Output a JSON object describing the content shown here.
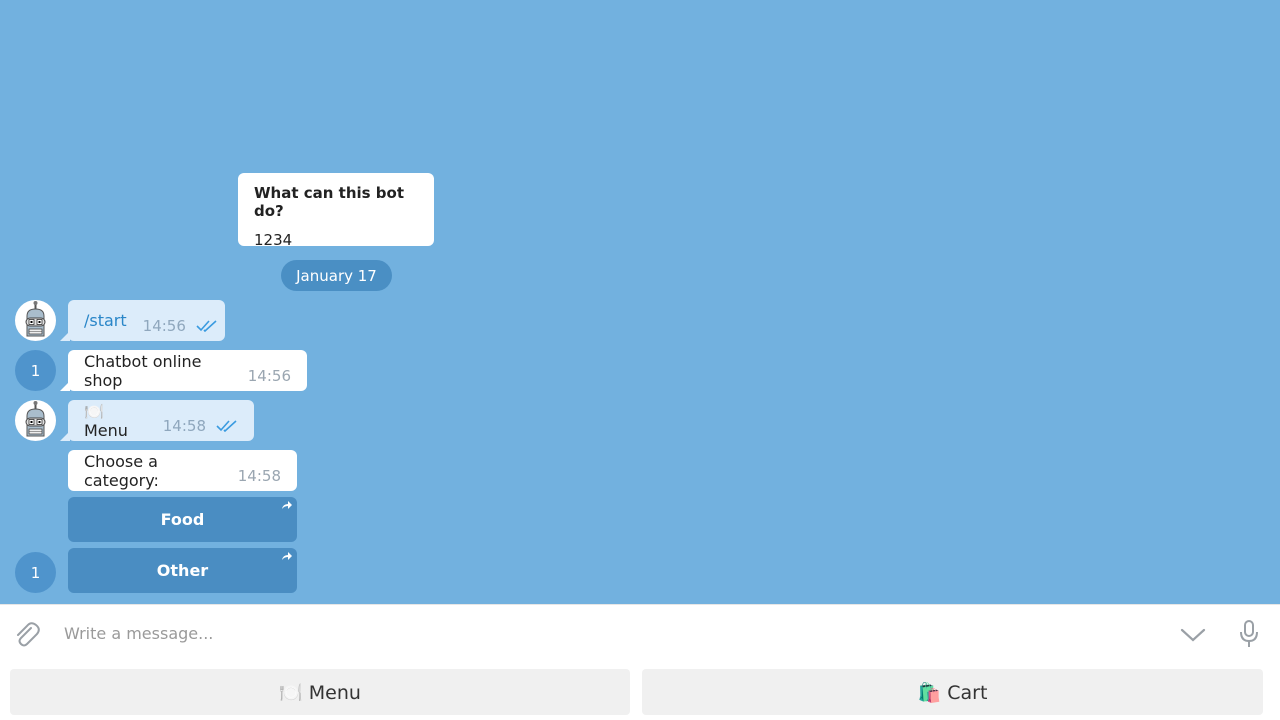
{
  "bot_info": {
    "title": "What can this bot do?",
    "body": "1234"
  },
  "date_separator": "January 17",
  "messages": [
    {
      "text": "/start",
      "time": "14:56"
    },
    {
      "text": "Chatbot online shop",
      "time": "14:56"
    },
    {
      "text": "🍽️ Menu",
      "time": "14:58"
    },
    {
      "text": "Choose a category:",
      "time": "14:58"
    }
  ],
  "user_avatar_label": "1",
  "inline_keyboard": [
    "Food",
    "Other"
  ],
  "composer": {
    "placeholder": "Write a message..."
  },
  "reply_keyboard": [
    "🍽️ Menu",
    "🛍️ Cart"
  ],
  "colors": {
    "chat_background": "#72b1df",
    "inline_button": "#4a8dc2",
    "outgoing_bubble": "#dcecfa",
    "read_checks": "#3a9be0"
  }
}
